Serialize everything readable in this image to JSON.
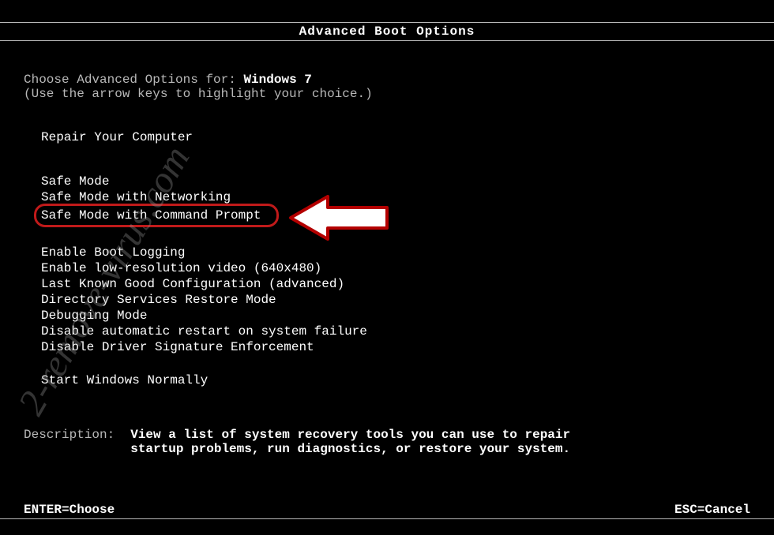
{
  "header": {
    "title": "Advanced Boot Options"
  },
  "intro": {
    "prefix": "Choose Advanced Options for: ",
    "os": "Windows 7",
    "hint": "(Use the arrow keys to highlight your choice.)"
  },
  "groups": [
    {
      "items": [
        {
          "label": "Repair Your Computer",
          "selected": false
        }
      ]
    },
    {
      "items": [
        {
          "label": "Safe Mode",
          "selected": false
        },
        {
          "label": "Safe Mode with Networking",
          "selected": false
        },
        {
          "label": "Safe Mode with Command Prompt",
          "selected": true
        }
      ]
    },
    {
      "items": [
        {
          "label": "Enable Boot Logging",
          "selected": false
        },
        {
          "label": "Enable low-resolution video (640x480)",
          "selected": false
        },
        {
          "label": "Last Known Good Configuration (advanced)",
          "selected": false
        },
        {
          "label": "Directory Services Restore Mode",
          "selected": false
        },
        {
          "label": "Debugging Mode",
          "selected": false
        },
        {
          "label": "Disable automatic restart on system failure",
          "selected": false
        },
        {
          "label": "Disable Driver Signature Enforcement",
          "selected": false
        }
      ]
    },
    {
      "items": [
        {
          "label": "Start Windows Normally",
          "selected": false
        }
      ]
    }
  ],
  "description": {
    "label": "Description:",
    "text": "View a list of system recovery tools you can use to repair startup problems, run diagnostics, or restore your system."
  },
  "footer": {
    "enter": "ENTER=Choose",
    "esc": "ESC=Cancel"
  },
  "watermark": "2-remove-virus.com"
}
